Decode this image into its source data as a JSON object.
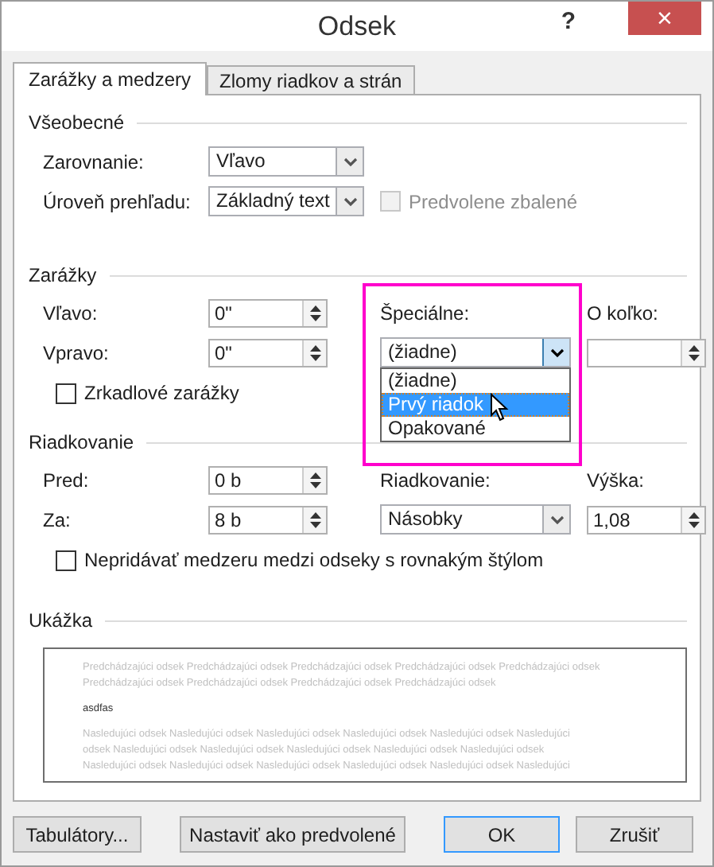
{
  "window": {
    "title": "Odsek",
    "help_button": "?",
    "close_button": "×"
  },
  "tabs": [
    {
      "label": "Zarážky a medzery",
      "selected": true
    },
    {
      "label": "Zlomy riadkov a strán",
      "selected": false
    }
  ],
  "general": {
    "heading": "Všeobecné",
    "alignment": {
      "label": "Zarovnanie:",
      "value": "Vľavo"
    },
    "outline_level": {
      "label": "Úroveň prehľadu:",
      "value": "Základný text"
    },
    "collapsed": {
      "label": "Predvolene zbalené",
      "checked": false,
      "disabled": true
    }
  },
  "indentation": {
    "heading": "Zarážky",
    "left": {
      "label": "Vľavo:",
      "value": "0\""
    },
    "right": {
      "label": "Vpravo:",
      "value": "0\""
    },
    "mirror": {
      "label": "Zrkadlové zarážky",
      "checked": false
    },
    "special": {
      "label": "Špeciálne:",
      "value": "(žiadne)",
      "expanded": true,
      "options": [
        {
          "label": "(žiadne)",
          "highlighted": false
        },
        {
          "label": "Prvý riadok",
          "highlighted": true
        },
        {
          "label": "Opakované",
          "highlighted": false
        }
      ]
    },
    "by": {
      "label": "O koľko:"
    }
  },
  "spacing": {
    "heading": "Riadkovanie",
    "before": {
      "label": "Pred:",
      "value": "0 b"
    },
    "after": {
      "label": "Za:",
      "value": "8 b"
    },
    "line_spacing": {
      "label": "Riadkovanie:",
      "value": "Násobky"
    },
    "at": {
      "label": "Výška:",
      "value": "1,08"
    },
    "dont_add": {
      "label": "Nepridávať medzeru medzi odseky s rovnakým štýlom",
      "checked": false
    }
  },
  "preview": {
    "heading": "Ukážka",
    "previous_lines": [
      "Predchádzajúci odsek Predchádzajúci odsek Predchádzajúci odsek Predchádzajúci odsek Predchádzajúci odsek",
      "Predchádzajúci odsek Predchádzajúci odsek Predchádzajúci odsek Predchádzajúci odsek"
    ],
    "current_line": "asdfas",
    "next_lines": [
      "Nasledujúci odsek Nasledujúci odsek Nasledujúci odsek Nasledujúci odsek Nasledujúci odsek Nasledujúci",
      "odsek Nasledujúci odsek Nasledujúci odsek Nasledujúci odsek Nasledujúci odsek Nasledujúci odsek",
      "Nasledujúci odsek Nasledujúci odsek Nasledujúci odsek Nasledujúci odsek Nasledujúci odsek Nasledujúci"
    ]
  },
  "buttons": [
    {
      "label": "Tabulátory...",
      "default": false
    },
    {
      "label": "Nastaviť ako predvolené",
      "default": false
    },
    {
      "label": "OK",
      "default": true
    },
    {
      "label": "Zrušiť",
      "default": false
    }
  ]
}
